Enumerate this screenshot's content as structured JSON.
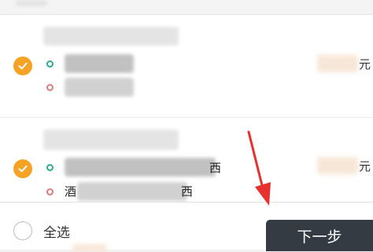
{
  "items": [
    {
      "price_suffix": "元",
      "checked": true
    },
    {
      "price_suffix": "元",
      "checked": true,
      "fragment_row1": "西",
      "fragment_row2": "酒",
      "fragment_row2_end": "西"
    }
  ],
  "footer": {
    "select_all_label": "全选",
    "next_button_label": "下一步"
  },
  "colors": {
    "accent_orange": "#f5a225",
    "green_dot": "#2fa98c",
    "red_dot": "#e07a7a",
    "next_button_bg": "#353b43",
    "annotation_arrow": "#e8312f"
  },
  "icons": {
    "checkmark": "checkmark-icon",
    "annotation": "red-arrow-annotation"
  }
}
